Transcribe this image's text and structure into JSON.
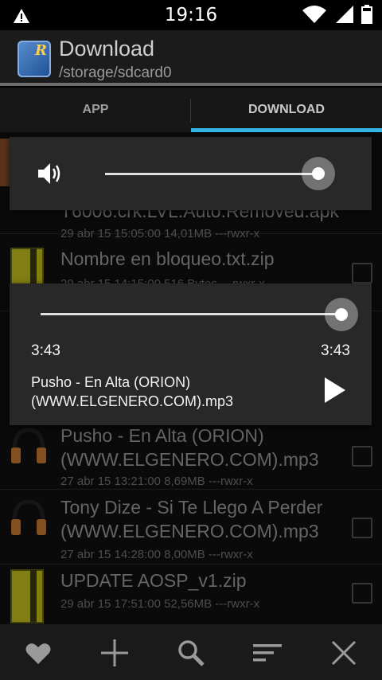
{
  "status": {
    "time": "19:16"
  },
  "header": {
    "title": "Download",
    "path": "/storage/sdcard0",
    "icon_letter": "R"
  },
  "tabs": [
    {
      "label": "APP"
    },
    {
      "label": "DOWNLOAD"
    }
  ],
  "list": {
    "partial_top": {
      "name": "T6006.crk.LVL.Auto.Removed.apk",
      "meta": "29 abr 15 15:05:00  14,01MB  ---rwxr-x"
    },
    "items": [
      {
        "name": "Nombre en bloqueo.txt.zip",
        "meta": "29 abr 15 14:15:00  516 Bytes  ---rwxr-x"
      },
      {
        "name_line1": "Pusho - En Alta (ORION)",
        "name_line2": "(WWW.ELGENERO.COM).mp3",
        "meta": "27 abr 15 13:21:00  8,69MB  ---rwxr-x"
      },
      {
        "name_line1": "Tony Dize  - Si Te Llego A Perder",
        "name_line2": "(WWW.ELGENERO.COM).mp3",
        "meta": "27 abr 15 14:28:00  8,00MB  ---rwxr-x"
      },
      {
        "name": "UPDATE AOSP_v1.zip",
        "meta": "29 abr 15 17:51:00  52,56MB  ---rwxr-x"
      }
    ]
  },
  "volume": {
    "level": 1.0
  },
  "player": {
    "progress": 1.0,
    "elapsed": "3:43",
    "total": "3:43",
    "song_line1": "Pusho - En Alta (ORION)",
    "song_line2": "(WWW.ELGENERO.COM).mp3"
  },
  "colors": {
    "accent": "#33b5e5"
  },
  "bottom_bar": [
    "heart-icon",
    "add-icon",
    "search-icon",
    "sort-icon",
    "close-icon"
  ]
}
